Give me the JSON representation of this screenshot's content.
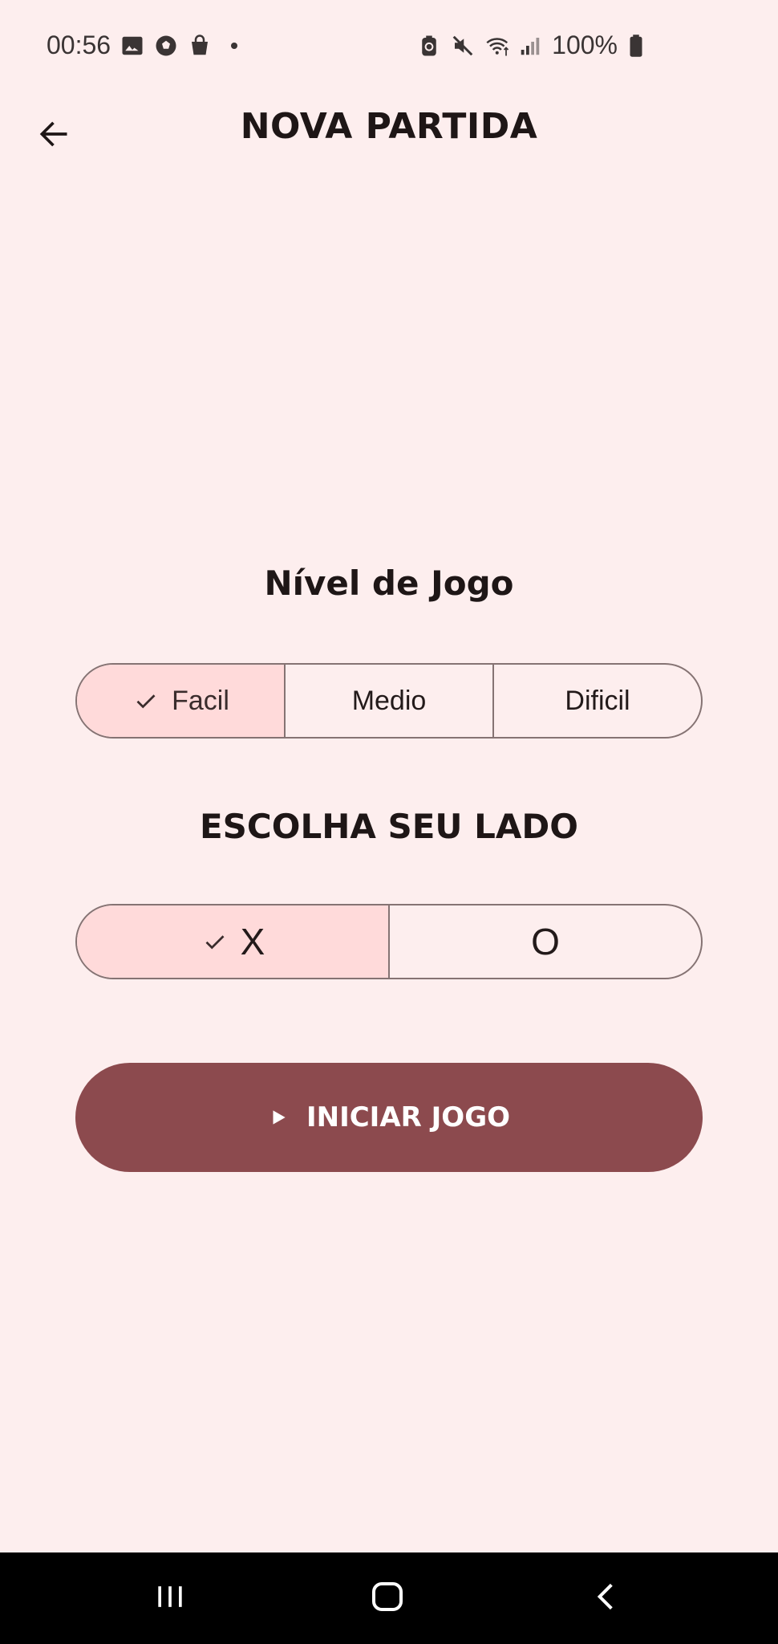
{
  "status_bar": {
    "time": "00:56",
    "battery": "100%"
  },
  "app_bar": {
    "title": "NOVA PARTIDA"
  },
  "level": {
    "heading": "Nível de Jogo",
    "options": [
      "Facil",
      "Medio",
      "Dificil"
    ],
    "selected": "Facil"
  },
  "side": {
    "heading": "Escolha seu lado",
    "options": [
      "X",
      "O"
    ],
    "selected": "X"
  },
  "start_button": {
    "label": "INICIAR JOGO"
  },
  "colors": {
    "background": "#fdeeee",
    "selected_segment": "#ffdada",
    "primary": "#8c4a4e",
    "outline": "#857373"
  },
  "icons": {
    "back": "arrow-left-icon",
    "check": "check-icon",
    "play": "play-icon"
  }
}
